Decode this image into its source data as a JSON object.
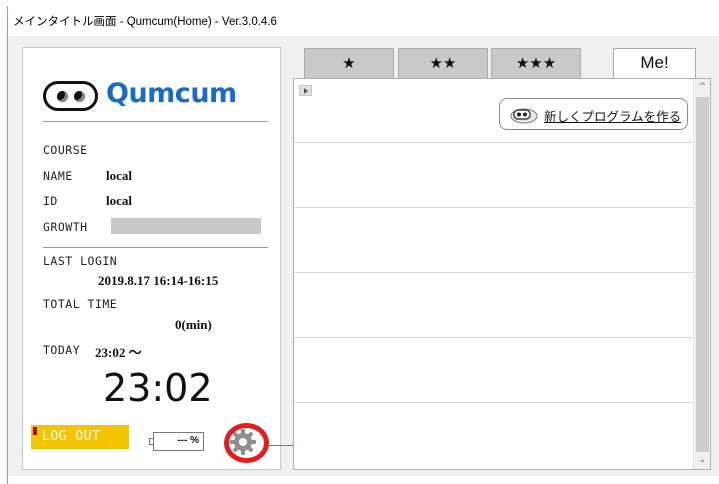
{
  "window": {
    "title": "メインタイトル画面 - Qumcum(Home) - Ver.3.0.4.6"
  },
  "profile": {
    "brand": "Qumcum",
    "course_label": "COURSE",
    "name_label": "NAME",
    "name_value": "local",
    "id_label": "ID",
    "id_value": "local",
    "growth_label": "GROWTH",
    "last_login_label": "LAST LOGIN",
    "last_login_value": "2019.8.17 16:14-16:15",
    "total_time_label": "TOTAL TIME",
    "total_time_value": "0(min)",
    "today_label": "TODAY",
    "today_value": "23:02 ～",
    "clock": "23:02"
  },
  "controls": {
    "logout_label": "LOG OUT",
    "battery_text": "--- %"
  },
  "tabs": [
    {
      "label": "★"
    },
    {
      "label": "★★"
    },
    {
      "label": "★★★"
    },
    {
      "label": "Me!"
    }
  ],
  "program_list": {
    "new_program_label": "新しくプログラムを作る"
  },
  "colors": {
    "accent_blue": "#1b6cc4",
    "logout_yellow": "#f5c400",
    "highlight_red": "#e31c1c"
  }
}
